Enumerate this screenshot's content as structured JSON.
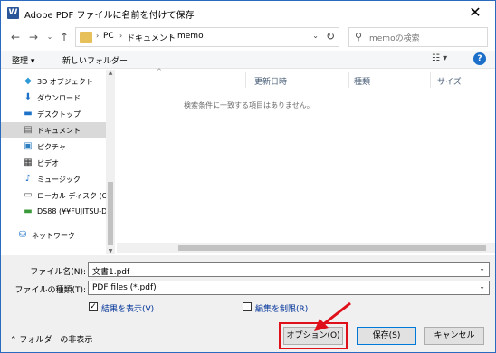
{
  "window": {
    "title": "Adobe PDF ファイルに名前を付けて保存",
    "app_icon": "W"
  },
  "nav": {
    "breadcrumbs": [
      "PC",
      "ドキュメント",
      "memo"
    ],
    "search_placeholder": "memoの検索"
  },
  "toolbar": {
    "organize": "整理 ▾",
    "new_folder": "新しいフォルダー",
    "help": "?"
  },
  "sidebar": {
    "items": [
      {
        "label": "3D オブジェクト",
        "icon": "cube-icon"
      },
      {
        "label": "ダウンロード",
        "icon": "download-icon"
      },
      {
        "label": "デスクトップ",
        "icon": "desktop-icon"
      },
      {
        "label": "ドキュメント",
        "icon": "document-icon",
        "selected": true
      },
      {
        "label": "ピクチャ",
        "icon": "picture-icon"
      },
      {
        "label": "ビデオ",
        "icon": "video-icon"
      },
      {
        "label": "ミュージック",
        "icon": "music-icon"
      },
      {
        "label": "ローカル ディスク (C:)",
        "icon": "drive-icon"
      },
      {
        "label": "DS88 (¥¥FUJITSU-D",
        "icon": "network-drive-icon"
      },
      {
        "label": "ネットワーク",
        "icon": "network-icon"
      }
    ]
  },
  "filelist": {
    "columns": [
      "更新日時",
      "種類",
      "サイズ"
    ],
    "empty_message": "検索条件に一致する項目はありません。"
  },
  "form": {
    "filename_label": "ファイル名(N):",
    "filename_value": "文書1.pdf",
    "filetype_label": "ファイルの種類(T):",
    "filetype_value": "PDF files (*.pdf)",
    "show_result_label": "結果を表示(V)",
    "show_result_checked": true,
    "restrict_edit_label": "編集を制限(R)",
    "restrict_edit_checked": false
  },
  "footer": {
    "hide_folders": "フォルダーの非表示",
    "options_button": "オプション(O)",
    "save_button": "保存(S)",
    "cancel_button": "キャンセル"
  },
  "colors": {
    "highlight": "#e0101a",
    "accent": "#0078d7"
  }
}
